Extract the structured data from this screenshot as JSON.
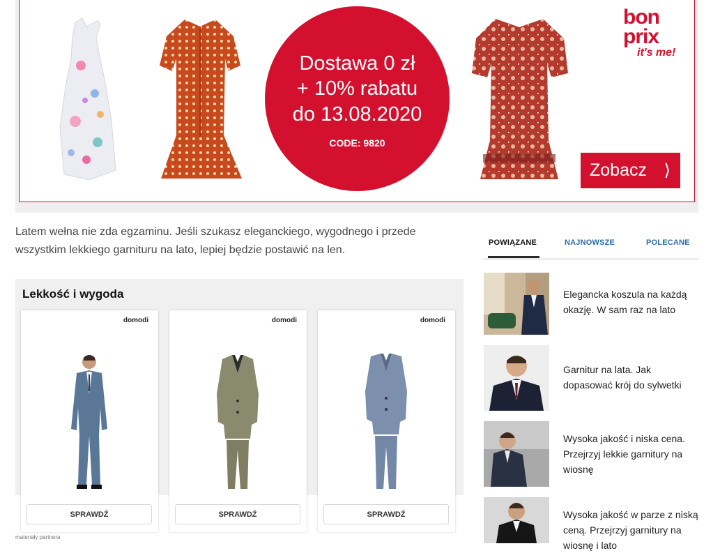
{
  "banner": {
    "promo_line1": "Dostawa 0 zł",
    "promo_line2": "+ 10% rabatu",
    "promo_line3": "do 13.08.2020",
    "promo_code": "CODE: 9820",
    "logo_line1": "bon",
    "logo_line2": "prix",
    "logo_line3": "it's me!",
    "cta_label": "Zobacz",
    "accent_color": "#d3112f"
  },
  "intro_text": "Latem wełna nie zda egzaminu. Jeśli szukasz eleganckiego, wygodnego i przede wszystkim lekkiego garnituru na lato, lepiej będzie postawić na len.",
  "products": {
    "heading": "Lekkość i wygoda",
    "items": [
      {
        "shop": "domodi",
        "button": "SPRAWDŹ",
        "suit_color": "#5b7797"
      },
      {
        "shop": "domodi",
        "button": "SPRAWDŹ",
        "suit_color": "#8a8a6e"
      },
      {
        "shop": "domodi",
        "button": "SPRAWDŹ",
        "suit_color": "#7c8fad"
      }
    ],
    "partner_note": "materiały partnera"
  },
  "sidebar": {
    "tabs": [
      {
        "label": "POWIĄZANE",
        "active": true
      },
      {
        "label": "NAJNOWSZE",
        "active": false
      },
      {
        "label": "POLECANE",
        "active": false
      }
    ],
    "articles": [
      {
        "title": "Elegancka koszula na każdą okazję. W sam raz na lato"
      },
      {
        "title": "Garnitur na lata. Jak dopasować krój do sylwetki"
      },
      {
        "title": "Wysoka jakość i niska cena. Przejrzyj lekkie garnitury na wiosnę"
      },
      {
        "title": "Wysoka jakość w parze z niską ceną. Przejrzyj garnitury na wiosnę i lato"
      }
    ]
  }
}
